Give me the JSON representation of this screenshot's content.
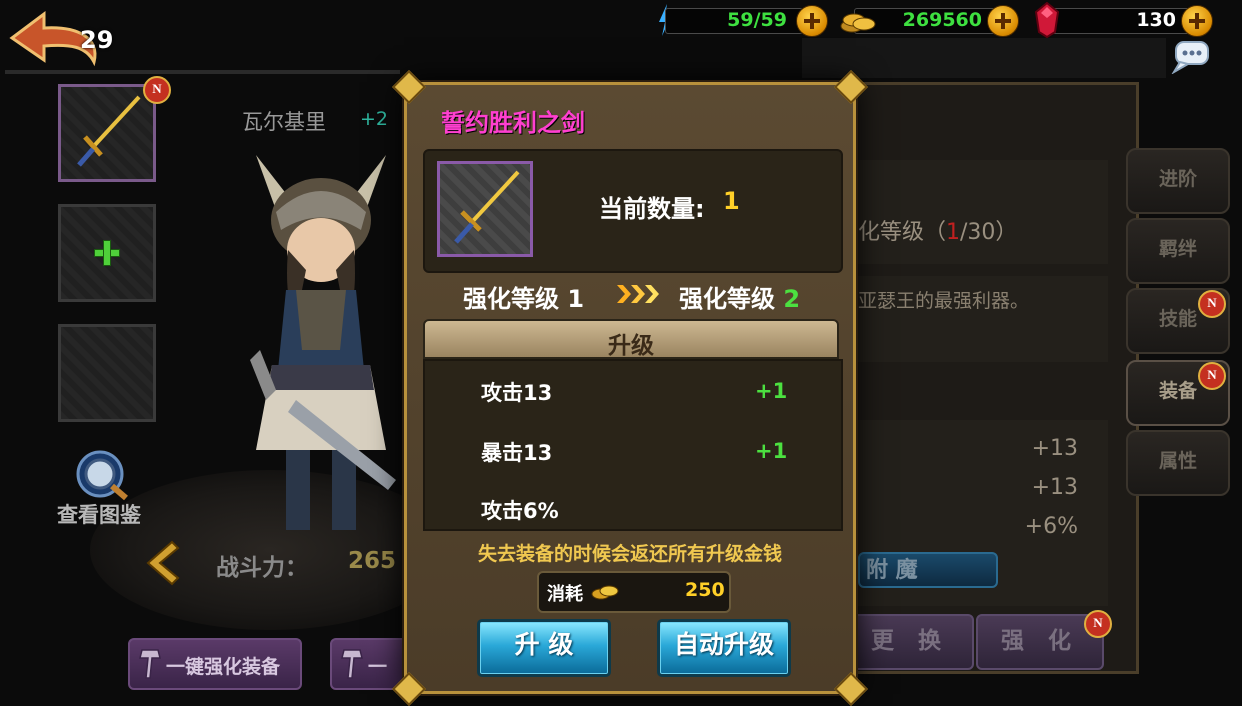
{
  "top": {
    "back_level": "29",
    "energy": "59/59",
    "gold": "269560",
    "gems": "130"
  },
  "hero": {
    "name": "瓦尔基里",
    "plus": "+2",
    "atlas_label": "查看图鉴",
    "power_label": "战斗力：",
    "power_value": "265"
  },
  "bottom_buttons": {
    "one_key_enhance": "一键强化装备",
    "second": "一"
  },
  "right_panel": {
    "level_text": "化等级（",
    "level_cur": "1",
    "level_max": "/30）",
    "desc": "亚瑟王的最强利器。",
    "stats": [
      "+13",
      "+13",
      "+6%"
    ],
    "enchant": "附 魔",
    "replace": "更 换",
    "enhance": "强 化",
    "tabs": [
      "进阶",
      "羁绊",
      "技能",
      "装备",
      "属性"
    ]
  },
  "dialog": {
    "title": "誓约胜利之剑",
    "qty_label": "当前数量:",
    "qty_value": "1",
    "lvl_from_label": "强化等级 1",
    "lvl_to_label": "强化等级",
    "lvl_to_value": "2",
    "section": "升级",
    "stats": [
      {
        "name": "攻击13",
        "delta": "+1"
      },
      {
        "name": "暴击13",
        "delta": "+1"
      },
      {
        "name": "攻击6%",
        "delta": ""
      }
    ],
    "note": "失去装备的时候会返还所有升级金钱",
    "cost_label": "消耗",
    "cost_value": "250",
    "upgrade_btn": "升 级",
    "auto_btn": "自动升级"
  },
  "colors": {
    "title": "#ff3fd0",
    "gold_text": "#ffd028",
    "green_text": "#4ce040"
  }
}
